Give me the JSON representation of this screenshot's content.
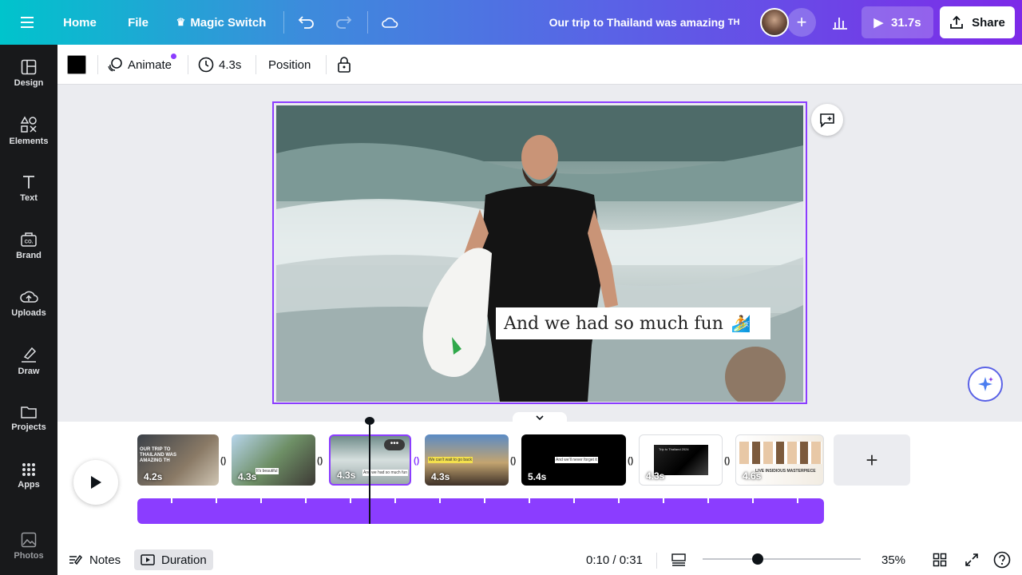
{
  "topbar": {
    "home": "Home",
    "file": "File",
    "magic_switch": "Magic Switch",
    "title": "Our trip to Thailand was amazing",
    "title_suffix": "TH",
    "play_duration": "31.7s",
    "share": "Share"
  },
  "sidebar": {
    "items": [
      {
        "label": "Design",
        "icon": "layout-icon"
      },
      {
        "label": "Elements",
        "icon": "shapes-icon"
      },
      {
        "label": "Text",
        "icon": "text-icon"
      },
      {
        "label": "Brand",
        "icon": "brand-icon"
      },
      {
        "label": "Uploads",
        "icon": "cloud-upload-icon"
      },
      {
        "label": "Draw",
        "icon": "pen-icon"
      },
      {
        "label": "Projects",
        "icon": "folder-icon"
      },
      {
        "label": "Apps",
        "icon": "grid-icon"
      },
      {
        "label": "Photos",
        "icon": "image-icon"
      }
    ]
  },
  "context_toolbar": {
    "color": "#000000",
    "animate": "Animate",
    "duration": "4.3s",
    "position": "Position"
  },
  "canvas": {
    "caption": "And we had so much fun",
    "caption_emoji": "🏄"
  },
  "timeline": {
    "clips": [
      {
        "duration": "4.2s",
        "text": "OUR TRIP TO THAILAND WAS AMAZING TH"
      },
      {
        "duration": "4.3s",
        "text": "It's beautiful"
      },
      {
        "duration": "4.3s",
        "text": "And we had so much fun"
      },
      {
        "duration": "4.3s",
        "text": "We can't wait to go back"
      },
      {
        "duration": "5.4s",
        "text": "And we'll never forget it"
      },
      {
        "duration": "4.3s",
        "text": "Trip to Thailand 2024"
      },
      {
        "duration": "4.6s",
        "text": "LIVE INSIDIOUS MASTERPIECE"
      }
    ]
  },
  "bottombar": {
    "notes": "Notes",
    "duration": "Duration",
    "time": "0:10 / 0:31",
    "zoom": "35%",
    "zoom_level": 0.35
  },
  "colors": {
    "accent": "#8b3dff",
    "sidebar_bg": "#18191b",
    "canvas_bg": "#ebecf0"
  }
}
